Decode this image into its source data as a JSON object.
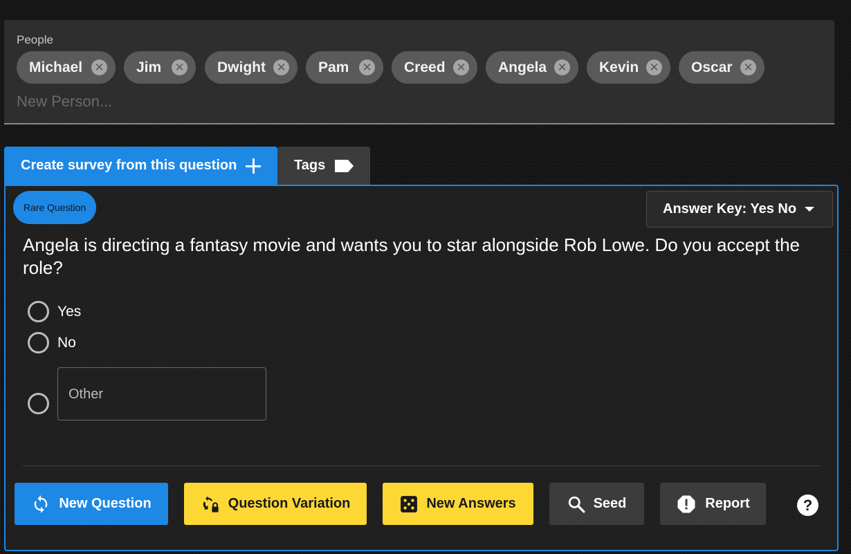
{
  "people": {
    "label": "People",
    "chips": [
      "Michael",
      "Jim",
      "Dwight",
      "Pam",
      "Creed",
      "Angela",
      "Kevin",
      "Oscar"
    ],
    "close_glyph": "✕",
    "input_placeholder": "New Person..."
  },
  "tabs": {
    "create_label": "Create survey from this question",
    "tags_label": "Tags"
  },
  "question": {
    "badge": "Rare Question",
    "answer_key": "Answer Key: Yes No",
    "text": "Angela is directing a fantasy movie and wants you to star alongside Rob Lowe. Do you accept the role?",
    "options": [
      "Yes",
      "No"
    ],
    "other_placeholder": "Other"
  },
  "actions": {
    "new_question": "New Question",
    "question_variation": "Question Variation",
    "new_answers": "New Answers",
    "seed": "Seed",
    "report": "Report",
    "help": "?"
  },
  "icons": {
    "create": "plus-icon",
    "tags": "tag-icon",
    "answer_key": "caret-down-icon",
    "new_question": "refresh-icon",
    "question_variation": "variation-lock-icon",
    "new_answers": "dice-icon",
    "seed": "search-icon",
    "report": "alert-octagon-icon",
    "help": "help-icon"
  },
  "colors": {
    "accent_blue": "#1e88e5",
    "accent_yellow": "#fdd835",
    "chip_bg": "#5a5a5a",
    "panel_bg": "#2e2e2e"
  }
}
